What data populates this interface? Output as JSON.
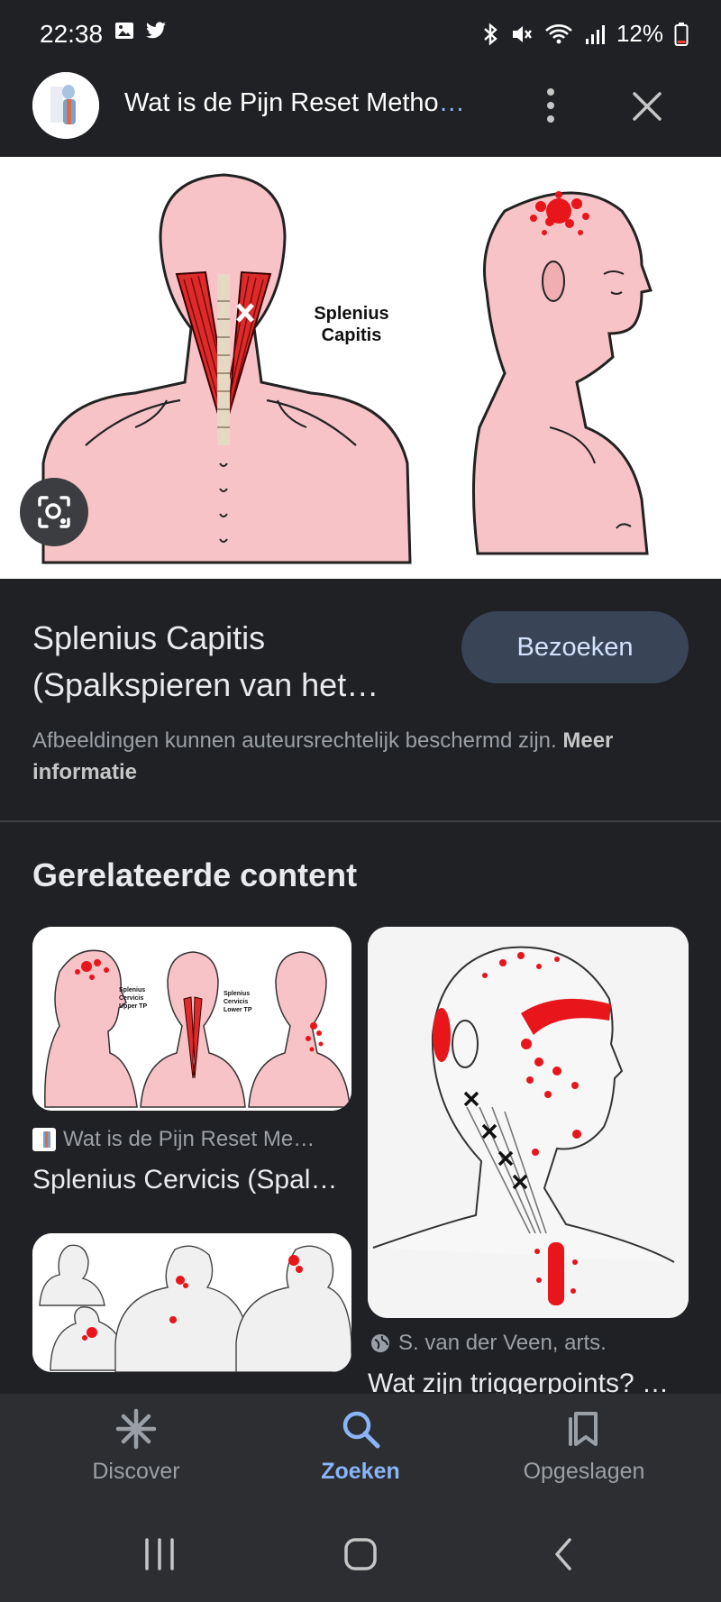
{
  "status_bar": {
    "time": "22:38",
    "battery": "12%",
    "icons": [
      "gallery-icon",
      "twitter-icon",
      "bluetooth-icon",
      "mute-icon",
      "wifi-icon",
      "signal-icon",
      "battery-icon"
    ]
  },
  "header": {
    "title": "Wat is de Pijn Reset Metho",
    "ellipsis": "…"
  },
  "hero": {
    "label": "Splenius\nCapitis",
    "label_line1": "Splenius",
    "label_line2": "Capitis"
  },
  "result": {
    "title_line1": "Splenius Capitis",
    "title_line2": "(Spalkspieren van het…",
    "visit_label": "Bezoeken",
    "copyright_text": "Afbeeldingen kunnen auteursrechtelijk beschermd zijn.",
    "more_info": "Meer informatie"
  },
  "related": {
    "heading": "Gerelateerde content",
    "cards": [
      {
        "source": "Wat is de Pijn Reset Me…",
        "title": "Splenius Cervicis (Spal…",
        "labels": [
          "Splenius",
          "Cervicis",
          "Upper TP",
          "Splenius",
          "Cervicis",
          "Lower TP"
        ]
      },
      {
        "source": "S. van der Veen, arts.",
        "title": "Wat zijn triggerpoints? …"
      }
    ]
  },
  "bottom_nav": {
    "items": [
      {
        "label": "Discover",
        "icon": "asterisk-icon",
        "active": false
      },
      {
        "label": "Zoeken",
        "icon": "search-icon",
        "active": true
      },
      {
        "label": "Opgeslagen",
        "icon": "bookmarks-icon",
        "active": false
      }
    ]
  },
  "colors": {
    "background": "#202124",
    "accent": "#8ab4f8",
    "visit_button": "#394457",
    "pain_red": "#e8151b"
  }
}
